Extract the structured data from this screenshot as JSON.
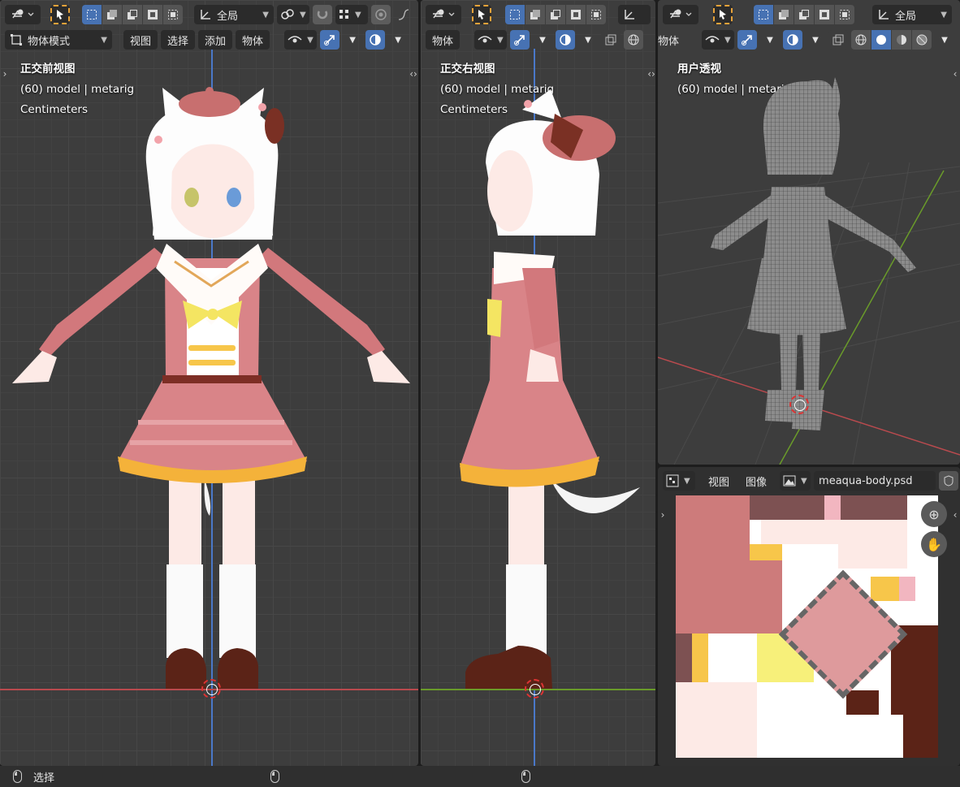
{
  "toolbar": {
    "transform_orientation": "全局",
    "mode": "物体模式",
    "menus": [
      "视图",
      "选择",
      "添加",
      "物体"
    ],
    "mid_menu": "物体",
    "right_menu": "物体"
  },
  "viewports": [
    {
      "title": "正交前视图",
      "info": "(60) model | metarig",
      "units": "Centimeters"
    },
    {
      "title": "正交右视图",
      "info": "(60) model | metarig",
      "units": "Centimeters"
    },
    {
      "title": "用户透视",
      "info": "(60) model | metarig"
    }
  ],
  "image_editor": {
    "menus": [
      "视图",
      "图像"
    ],
    "image_name": "meaqua-body.psd"
  },
  "statusbar": {
    "left_label": "选择"
  },
  "icons": {
    "editor_type": "view3d-icon",
    "select_tool": "cursor-icon",
    "object_mode": "object-mode-icon"
  },
  "colors": {
    "accent_blue": "#4772b3",
    "axis_x": "#c0393f",
    "axis_y": "#6a9b2a",
    "axis_z": "#4a78c8",
    "viewport_bg": "#3d3d3d"
  }
}
